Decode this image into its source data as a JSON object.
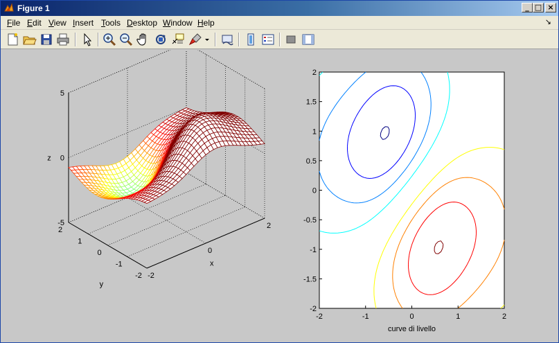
{
  "window": {
    "title": "Figure 1",
    "icon": "matlab-figure-icon"
  },
  "menu": {
    "items": [
      {
        "key": "F",
        "rest": "ile"
      },
      {
        "key": "E",
        "rest": "dit"
      },
      {
        "key": "V",
        "rest": "iew"
      },
      {
        "key": "I",
        "rest": "nsert"
      },
      {
        "key": "T",
        "rest": "ools"
      },
      {
        "key": "D",
        "rest": "esktop"
      },
      {
        "key": "W",
        "rest": "indow"
      },
      {
        "key": "H",
        "rest": "elp"
      }
    ],
    "dock_arrow": "↘"
  },
  "toolbar": {
    "buttons": [
      "new-figure-icon",
      "open-file-icon",
      "save-icon",
      "print-icon",
      "edit-plot-arrow-icon",
      "zoom-in-icon",
      "zoom-out-icon",
      "pan-hand-icon",
      "rotate-3d-icon",
      "data-cursor-icon",
      "brush-icon",
      "link-plot-icon",
      "colorbar-icon",
      "legend-icon",
      "hide-plot-tools-icon",
      "show-plot-tools-icon"
    ]
  },
  "chart_data": [
    {
      "type": "surface",
      "title": "",
      "xlabel": "x",
      "ylabel": "y",
      "zlabel": "z",
      "xlim": [
        -2,
        2
      ],
      "ylim": [
        -2,
        2
      ],
      "zlim": [
        -5,
        5
      ],
      "x_ticks": [
        "-2",
        "0",
        "2"
      ],
      "y_ticks": [
        "-2",
        "-1",
        "0",
        "1",
        "2"
      ],
      "z_ticks": [
        "-5",
        "0",
        "5"
      ],
      "grid": true,
      "colormap": "jet",
      "style": "mesh"
    },
    {
      "type": "contour",
      "title": "",
      "xlabel": "curve di livello",
      "ylabel": "",
      "xlim": [
        -2,
        2
      ],
      "ylim": [
        -2,
        2
      ],
      "x_ticks": [
        "-2",
        "-1",
        "0",
        "1",
        "2"
      ],
      "y_ticks": [
        "2",
        "1.5",
        "1",
        "0.5",
        "0",
        "-0.5",
        "-1",
        "-1.5",
        "-2"
      ],
      "colormap": "jet"
    }
  ],
  "colors": {
    "titlebar": "#0a246a",
    "menubar": "#ece9d8",
    "figure_bg": "#c8c8c8"
  }
}
